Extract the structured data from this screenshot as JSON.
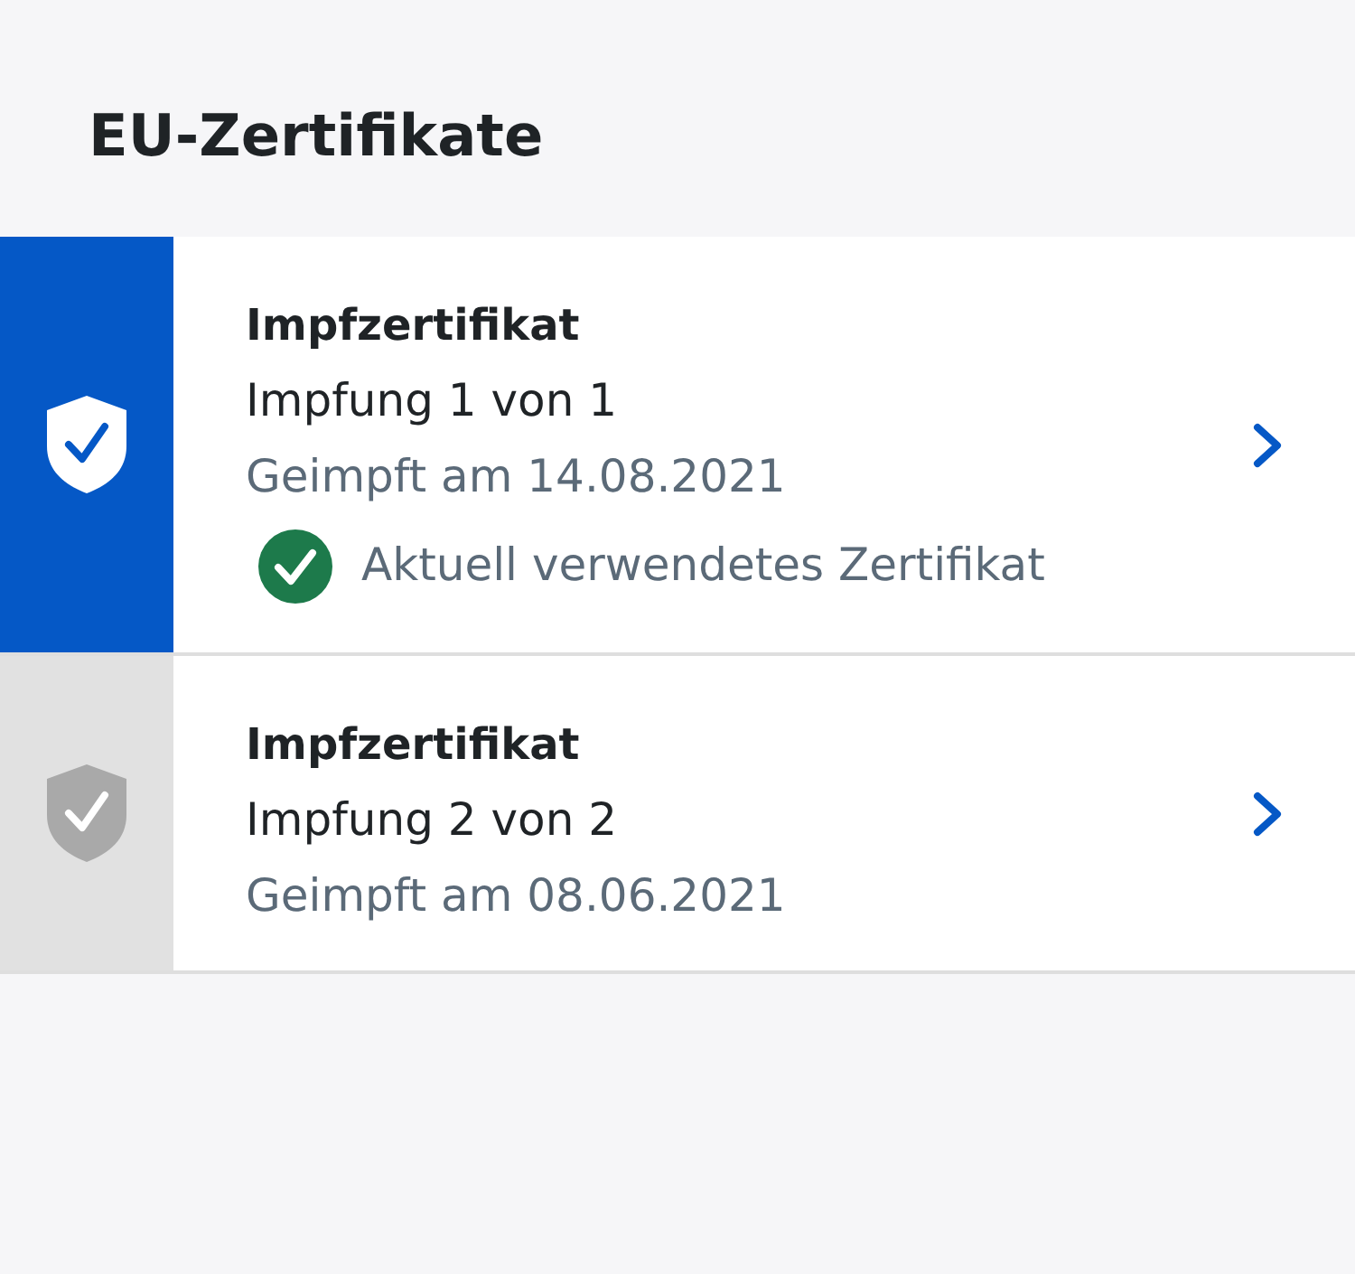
{
  "header": {
    "title": "EU-Zertifikate"
  },
  "certificates": [
    {
      "title": "Impfzertifikat",
      "dose": "Impfung 1 von 1",
      "date": "Geimpft am 14.08.2021",
      "current": true,
      "status": "Aktuell verwendetes Zertifikat"
    },
    {
      "title": "Impfzertifikat",
      "dose": "Impfung 2 von 2",
      "date": "Geimpft am 08.06.2021",
      "current": false
    }
  ]
}
